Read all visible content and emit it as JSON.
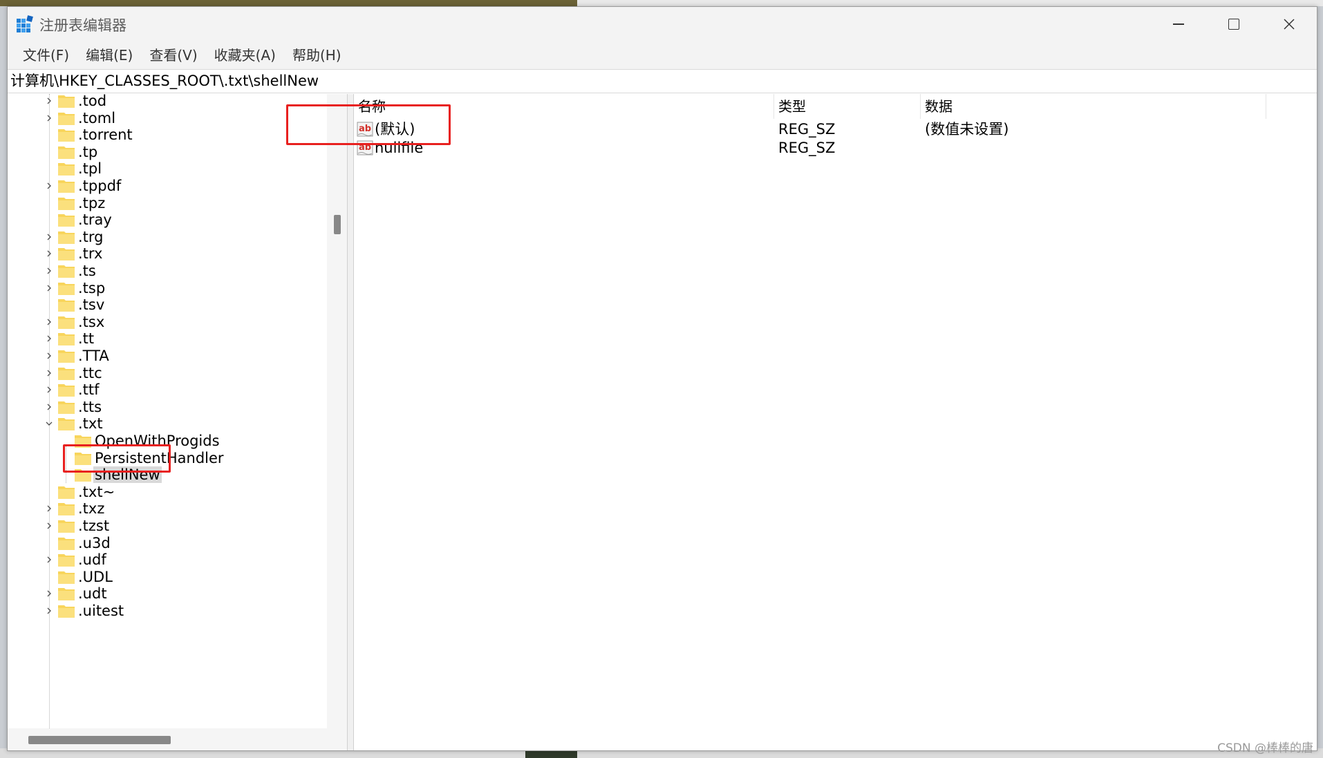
{
  "window": {
    "title": "注册表编辑器",
    "icon": "regedit-icon"
  },
  "menu": {
    "items": [
      "文件(F)",
      "编辑(E)",
      "查看(V)",
      "收藏夹(A)",
      "帮助(H)"
    ]
  },
  "address": {
    "path": "计算机\\HKEY_CLASSES_ROOT\\.txt\\shellNew"
  },
  "tree": {
    "items": [
      {
        "label": ".tod",
        "expandable": true,
        "level": 0
      },
      {
        "label": ".toml",
        "expandable": true,
        "level": 0
      },
      {
        "label": ".torrent",
        "expandable": false,
        "level": 0
      },
      {
        "label": ".tp",
        "expandable": false,
        "level": 0
      },
      {
        "label": ".tpl",
        "expandable": false,
        "level": 0
      },
      {
        "label": ".tppdf",
        "expandable": true,
        "level": 0
      },
      {
        "label": ".tpz",
        "expandable": false,
        "level": 0
      },
      {
        "label": ".tray",
        "expandable": false,
        "level": 0
      },
      {
        "label": ".trg",
        "expandable": true,
        "level": 0
      },
      {
        "label": ".trx",
        "expandable": true,
        "level": 0
      },
      {
        "label": ".ts",
        "expandable": true,
        "level": 0
      },
      {
        "label": ".tsp",
        "expandable": true,
        "level": 0
      },
      {
        "label": ".tsv",
        "expandable": false,
        "level": 0
      },
      {
        "label": ".tsx",
        "expandable": true,
        "level": 0
      },
      {
        "label": ".tt",
        "expandable": true,
        "level": 0
      },
      {
        "label": ".TTA",
        "expandable": true,
        "level": 0
      },
      {
        "label": ".ttc",
        "expandable": true,
        "level": 0
      },
      {
        "label": ".ttf",
        "expandable": true,
        "level": 0
      },
      {
        "label": ".tts",
        "expandable": true,
        "level": 0
      },
      {
        "label": ".txt",
        "expandable": true,
        "expanded": true,
        "level": 0
      },
      {
        "label": "OpenWithProgids",
        "expandable": false,
        "level": 1
      },
      {
        "label": "PersistentHandler",
        "expandable": false,
        "level": 1
      },
      {
        "label": "shellNew",
        "expandable": false,
        "level": 1,
        "selected": true
      },
      {
        "label": ".txt~",
        "expandable": false,
        "level": 0
      },
      {
        "label": ".txz",
        "expandable": true,
        "level": 0
      },
      {
        "label": ".tzst",
        "expandable": true,
        "level": 0
      },
      {
        "label": ".u3d",
        "expandable": false,
        "level": 0
      },
      {
        "label": ".udf",
        "expandable": true,
        "level": 0
      },
      {
        "label": ".UDL",
        "expandable": false,
        "level": 0
      },
      {
        "label": ".udt",
        "expandable": true,
        "level": 0
      },
      {
        "label": ".uitest",
        "expandable": true,
        "level": 0
      }
    ]
  },
  "list": {
    "headers": {
      "name": "名称",
      "type": "类型",
      "data": "数据"
    },
    "rows": [
      {
        "name": "(默认)",
        "type": "REG_SZ",
        "data": "(数值未设置)",
        "icon": "reg-sz-icon"
      },
      {
        "name": "nullfile",
        "type": "REG_SZ",
        "data": "",
        "icon": "reg-sz-icon"
      }
    ]
  },
  "colors": {
    "annotation": "#e8201f",
    "folder": "#f8d55c",
    "selection": "#d9d9d9"
  },
  "watermark": "CSDN @棒棒的唐"
}
